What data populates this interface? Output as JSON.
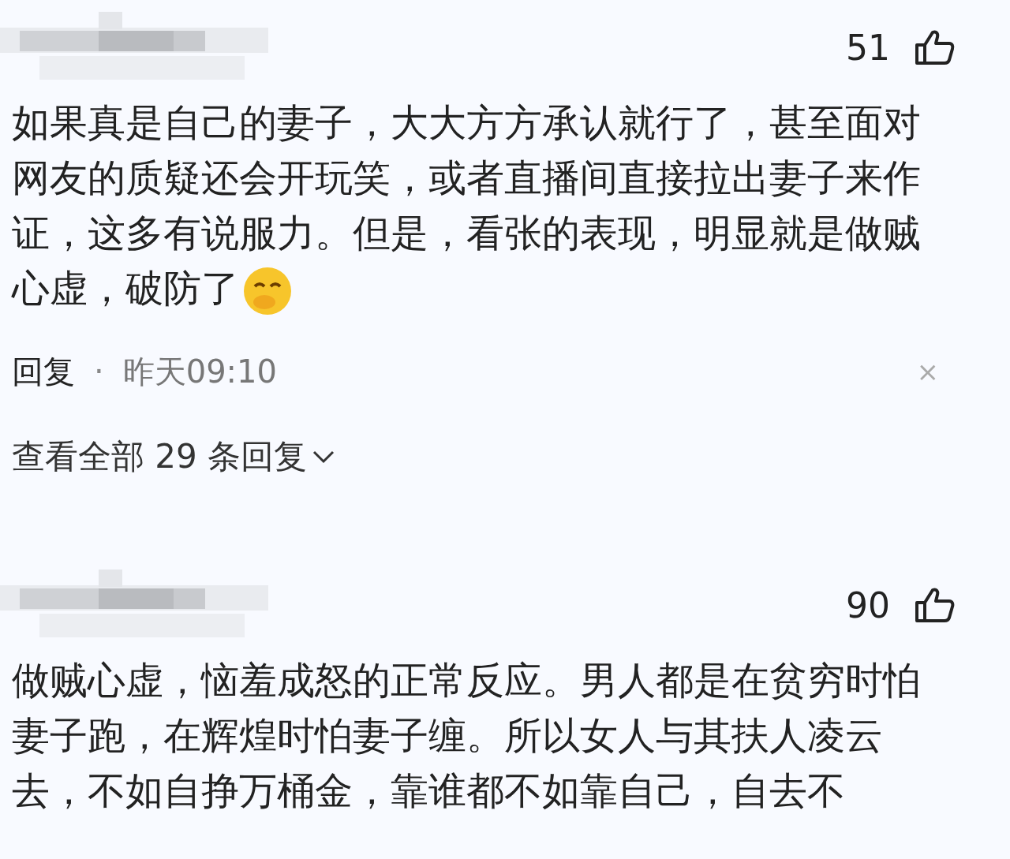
{
  "comments": [
    {
      "likes": "51",
      "text": "如果真是自己的妻子，大大方方承认就行了，甚至面对网友的质疑还会开玩笑，或者直播间直接拉出妻子来作证，这多有说服力。但是，看张的表现，明显就是做贼心虚，破防了",
      "emoji": true,
      "reply_label": "回复",
      "separator": "·",
      "time": "昨天09:10",
      "close": "×",
      "view_replies": "查看全部 29 条回复"
    },
    {
      "likes": "90",
      "text": "做贼心虚，恼羞成怒的正常反应。男人都是在贫穷时怕妻子跑，在辉煌时怕妻子缠。所以女人与其扶人凌云去，不如自挣万桶金，靠谁都不如靠自己，自去不"
    }
  ]
}
